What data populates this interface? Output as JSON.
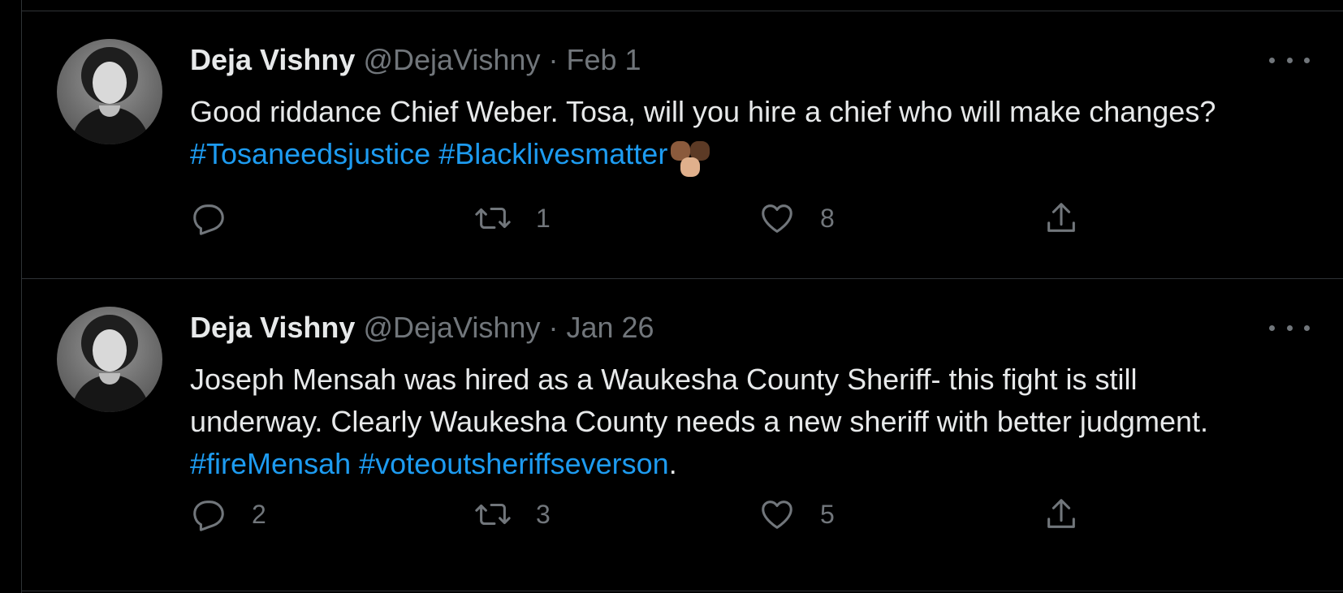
{
  "tweets": [
    {
      "author_name": "Deja Vishny",
      "author_handle": "@DejaVishny",
      "separator": "·",
      "date": "Feb 1",
      "text_plain": "Good riddance Chief Weber. Tosa, will you hire a chief who will make changes?",
      "hashtags": [
        "#Tosaneedsjustice",
        "#Blacklivesmatter"
      ],
      "text_end": "",
      "reply_count": "",
      "retweet_count": "1",
      "like_count": "8"
    },
    {
      "author_name": "Deja Vishny",
      "author_handle": "@DejaVishny",
      "separator": "·",
      "date": "Jan 26",
      "text_plain": "Joseph Mensah was hired as a Waukesha County Sheriff- this fight is still underway. Clearly Waukesha County needs a new sheriff with better judgment.",
      "hashtags": [
        "#fireMensah",
        "#voteoutsheriffseverson"
      ],
      "text_end": ".",
      "reply_count": "2",
      "retweet_count": "3",
      "like_count": "5"
    }
  ],
  "icons": {
    "reply": "reply-icon",
    "retweet": "retweet-icon",
    "like": "heart-icon",
    "share": "share-icon",
    "more": "more-icon",
    "emoji": "raised-fists-emoji"
  },
  "colors": {
    "background": "#000000",
    "text": "#e7e9ea",
    "secondary": "#71767b",
    "link": "#1d9bf0",
    "divider": "#2f3336"
  }
}
